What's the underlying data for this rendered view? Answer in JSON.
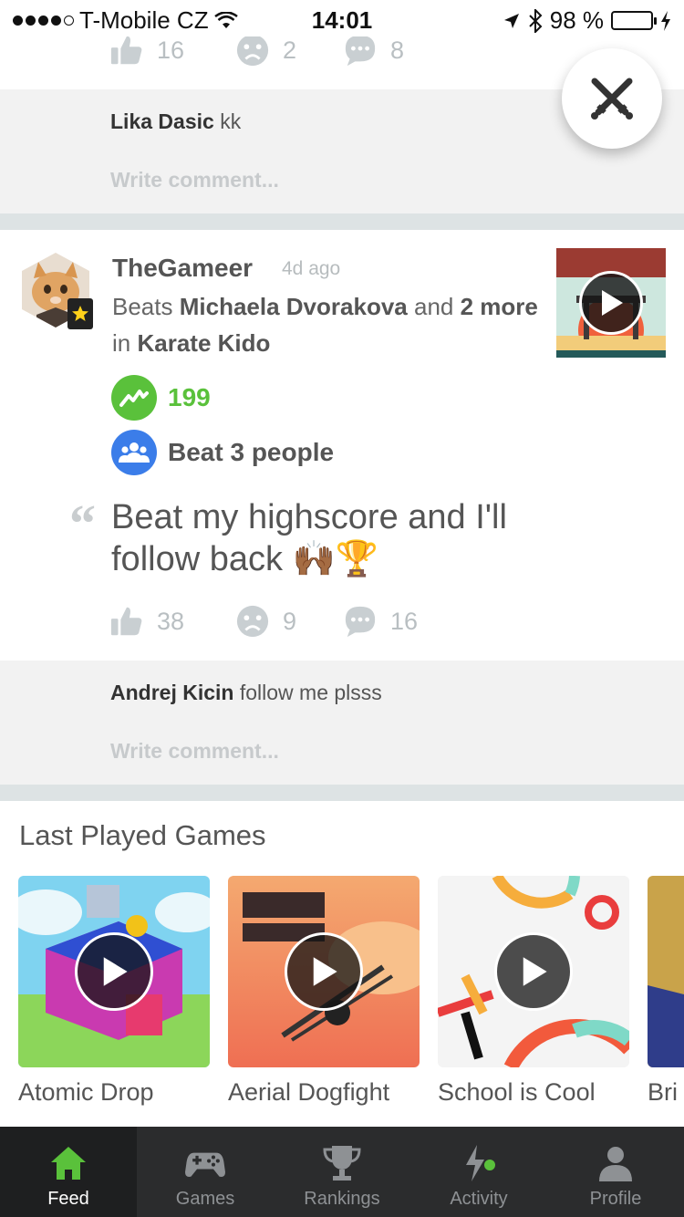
{
  "status_bar": {
    "carrier": "T-Mobile CZ",
    "time": "14:01",
    "battery": "98 %"
  },
  "prev_post": {
    "likes": "16",
    "sad": "2",
    "comments": "8",
    "comment_author": "Lika Dasic",
    "comment_text": "kk",
    "write_placeholder": "Write comment..."
  },
  "post": {
    "username": "TheGameer",
    "time_ago": "4d ago",
    "beats_prefix": "Beats",
    "beaten_user": "Michaela Dvorakova",
    "and_word": "and",
    "more_count": "2 more",
    "in_word": "in",
    "game": "Karate Kido",
    "score": "199",
    "beat_people": "Beat 3 people",
    "quote": "Beat my highscore and I'll follow back 🙌🏾🏆",
    "likes": "38",
    "sad": "9",
    "comments": "16",
    "comment_author": "Andrej Kicin",
    "comment_text": "follow me plsss",
    "write_placeholder": "Write comment..."
  },
  "last_played": {
    "title": "Last Played Games",
    "games": [
      {
        "name": "Atomic Drop"
      },
      {
        "name": "Aerial Dogfight"
      },
      {
        "name": "School is Cool"
      },
      {
        "name": "Bri"
      }
    ]
  },
  "tabs": [
    {
      "label": "Feed",
      "icon": "home-icon",
      "active": true
    },
    {
      "label": "Games",
      "icon": "gamepad-icon"
    },
    {
      "label": "Rankings",
      "icon": "trophy-icon"
    },
    {
      "label": "Activity",
      "icon": "activity-icon"
    },
    {
      "label": "Profile",
      "icon": "person-icon"
    }
  ],
  "colors": {
    "green": "#5ac13b",
    "blue": "#3b7de9",
    "tab_bg": "#2b2c2d"
  }
}
